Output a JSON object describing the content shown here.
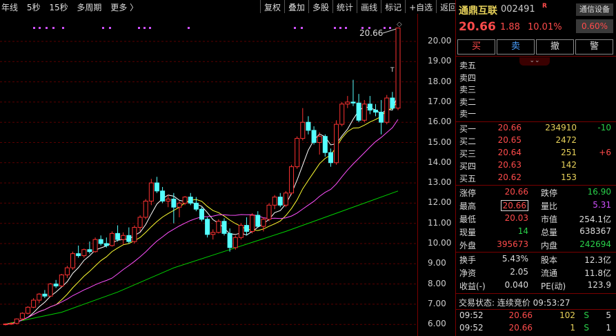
{
  "toolbar": {
    "left": [
      "年线",
      "5秒",
      "15秒",
      "多周期",
      "更多 〉"
    ],
    "right": [
      "复权",
      "叠加",
      "多股",
      "统计",
      "画线",
      "标记",
      "+自选",
      "返回"
    ]
  },
  "chart_data": {
    "type": "candlestick",
    "y_ticks": [
      "20.00",
      "19.00",
      "18.00",
      "17.00",
      "16.00",
      "15.00",
      "14.00",
      "13.00",
      "12.00",
      "11.00",
      "10.00",
      "9.00",
      "8.00",
      "7.00",
      "6.00"
    ],
    "last_price_label": "20.66",
    "grid": "dashed horizontal",
    "colors": {
      "up": "#ff3232",
      "down": "#54ffff",
      "ma5": "#ffffff",
      "ma10": "#ffff32",
      "ma20": "#ff50ff",
      "ma60": "#00d200"
    },
    "candles": [
      [
        6.0,
        6.05,
        5.95,
        6.02
      ],
      [
        6.02,
        6.1,
        5.97,
        6.05
      ],
      [
        6.05,
        6.3,
        6.0,
        6.27
      ],
      [
        6.27,
        6.6,
        6.2,
        6.55
      ],
      [
        6.55,
        6.9,
        6.5,
        6.85
      ],
      [
        6.85,
        7.3,
        6.8,
        7.2
      ],
      [
        7.2,
        7.55,
        7.05,
        7.5
      ],
      [
        7.5,
        7.7,
        7.3,
        7.4
      ],
      [
        7.4,
        8.05,
        7.35,
        8.0
      ],
      [
        8.0,
        8.2,
        7.8,
        7.9
      ],
      [
        7.9,
        8.5,
        7.85,
        8.45
      ],
      [
        8.45,
        8.9,
        8.3,
        8.8
      ],
      [
        8.8,
        9.6,
        8.7,
        9.5
      ],
      [
        9.5,
        9.9,
        9.3,
        9.4
      ],
      [
        9.4,
        9.75,
        9.3,
        9.7
      ],
      [
        9.7,
        10.1,
        9.5,
        9.6
      ],
      [
        9.6,
        10.3,
        9.55,
        10.2
      ],
      [
        10.2,
        10.4,
        9.9,
        10.0
      ],
      [
        10.0,
        10.3,
        9.8,
        9.9
      ],
      [
        9.9,
        10.6,
        9.85,
        10.5
      ],
      [
        10.5,
        10.9,
        10.1,
        10.2
      ],
      [
        10.2,
        10.55,
        9.95,
        10.4
      ],
      [
        10.4,
        10.8,
        10.0,
        10.1
      ],
      [
        10.1,
        10.9,
        10.0,
        10.8
      ],
      [
        10.8,
        11.4,
        10.6,
        11.3
      ],
      [
        11.3,
        12.2,
        11.2,
        12.1
      ],
      [
        12.1,
        13.2,
        11.9,
        13.0
      ],
      [
        13.0,
        13.3,
        12.5,
        12.6
      ],
      [
        12.6,
        12.8,
        12.0,
        12.1
      ],
      [
        12.1,
        12.4,
        11.8,
        12.2
      ],
      [
        12.2,
        12.5,
        11.0,
        11.8
      ],
      [
        11.8,
        12.1,
        11.3,
        12.0
      ],
      [
        12.0,
        12.35,
        11.9,
        12.3
      ],
      [
        12.3,
        12.5,
        11.9,
        12.0
      ],
      [
        12.0,
        12.3,
        11.6,
        11.7
      ],
      [
        11.7,
        11.8,
        11.1,
        11.2
      ],
      [
        11.2,
        11.3,
        10.3,
        10.45
      ],
      [
        10.45,
        10.7,
        10.2,
        10.55
      ],
      [
        10.55,
        11.2,
        10.5,
        11.1
      ],
      [
        11.1,
        11.25,
        10.4,
        10.5
      ],
      [
        10.5,
        10.75,
        9.6,
        9.8
      ],
      [
        9.8,
        10.4,
        9.7,
        10.3
      ],
      [
        10.3,
        11.0,
        10.2,
        10.9
      ],
      [
        10.9,
        11.3,
        10.4,
        10.6
      ],
      [
        10.6,
        11.5,
        10.5,
        11.4
      ],
      [
        11.4,
        11.6,
        10.8,
        10.85
      ],
      [
        10.85,
        11.3,
        10.6,
        11.2
      ],
      [
        11.2,
        12.0,
        11.1,
        11.9
      ],
      [
        11.9,
        12.4,
        11.7,
        12.3
      ],
      [
        12.3,
        12.5,
        11.8,
        11.9
      ],
      [
        11.9,
        12.6,
        11.8,
        12.5
      ],
      [
        12.5,
        13.9,
        12.4,
        13.8
      ],
      [
        13.8,
        15.3,
        13.7,
        15.2
      ],
      [
        15.2,
        16.7,
        15.1,
        16.0
      ],
      [
        16.0,
        16.3,
        15.4,
        15.6
      ],
      [
        15.6,
        15.8,
        14.9,
        15.0
      ],
      [
        15.0,
        15.5,
        14.4,
        15.3
      ],
      [
        15.3,
        15.4,
        14.3,
        14.5
      ],
      [
        14.5,
        14.7,
        13.8,
        14.0
      ],
      [
        14.0,
        16.1,
        13.9,
        15.9
      ],
      [
        15.9,
        17.0,
        15.8,
        16.9
      ],
      [
        16.9,
        17.3,
        16.7,
        17.0
      ],
      [
        17.0,
        18.1,
        16.8,
        16.95
      ],
      [
        16.95,
        17.4,
        16.0,
        16.1
      ],
      [
        16.1,
        17.1,
        16.0,
        16.9
      ],
      [
        16.9,
        17.3,
        16.4,
        16.6
      ],
      [
        16.6,
        16.9,
        16.3,
        16.5
      ],
      [
        16.5,
        17.1,
        15.4,
        16.0
      ],
      [
        16.0,
        17.35,
        15.9,
        17.2
      ],
      [
        17.2,
        17.5,
        16.6,
        16.7
      ],
      [
        16.7,
        20.66,
        16.6,
        20.66
      ]
    ],
    "ma60_path": [
      [
        6.02,
        0
      ],
      [
        6.6,
        10
      ],
      [
        7.6,
        20
      ],
      [
        8.8,
        30
      ],
      [
        9.7,
        40
      ],
      [
        10.6,
        50
      ],
      [
        11.6,
        60
      ],
      [
        12.6,
        70
      ]
    ],
    "marker_label": "T",
    "diamond_label": "◇"
  },
  "quote": {
    "name": "通鼎互联",
    "code": "002491",
    "badge": "R",
    "setting": "通信设备",
    "price": "20.66",
    "change": "1.88",
    "change_pct": "10.01%",
    "pct_badge": "0.60%",
    "buttons": [
      "买",
      "卖",
      "撤",
      "警"
    ],
    "sell_levels": [
      "卖五",
      "卖四",
      "卖三",
      "卖二",
      "卖一"
    ],
    "buy_levels": [
      {
        "label": "买一",
        "price": "20.66",
        "vol": "234910",
        "delta": "-10"
      },
      {
        "label": "买二",
        "price": "20.65",
        "vol": "2472",
        "delta": ""
      },
      {
        "label": "买三",
        "price": "20.64",
        "vol": "251",
        "delta": "+6"
      },
      {
        "label": "买四",
        "price": "20.63",
        "vol": "142",
        "delta": ""
      },
      {
        "label": "买五",
        "price": "20.62",
        "vol": "153",
        "delta": ""
      }
    ],
    "stats": [
      {
        "l1": "涨停",
        "v1": "20.66",
        "l2": "跌停",
        "v2": "16.90"
      },
      {
        "l1": "最高",
        "v1": "20.66",
        "l2": "量比",
        "v2": "5.31"
      },
      {
        "l1": "最低",
        "v1": "20.03",
        "l2": "市值",
        "v2": "254.1亿"
      },
      {
        "l1": "现量",
        "v1": "14",
        "l2": "总量",
        "v2": "638367"
      },
      {
        "l1": "外盘",
        "v1": "395673",
        "l2": "内盘",
        "v2": "242694"
      }
    ],
    "stats2": [
      {
        "l1": "换手",
        "v1": "5.43%",
        "l2": "股本",
        "v2": "12.3亿"
      },
      {
        "l1": "净资",
        "v1": "2.05",
        "l2": "流通",
        "v2": "11.8亿"
      },
      {
        "l1": "收益(-)",
        "v1": "0.040",
        "l2": "PE(动)",
        "v2": "123.9"
      }
    ],
    "trade_status": "交易状态: 连续竞价 09:53:27",
    "ticks": [
      {
        "time": "09:52",
        "price": "20.66",
        "vol": "102",
        "side": "S",
        "n": "5"
      },
      {
        "time": "09:52",
        "price": "20.66",
        "vol": "1",
        "side": "S",
        "n": "1"
      }
    ]
  }
}
